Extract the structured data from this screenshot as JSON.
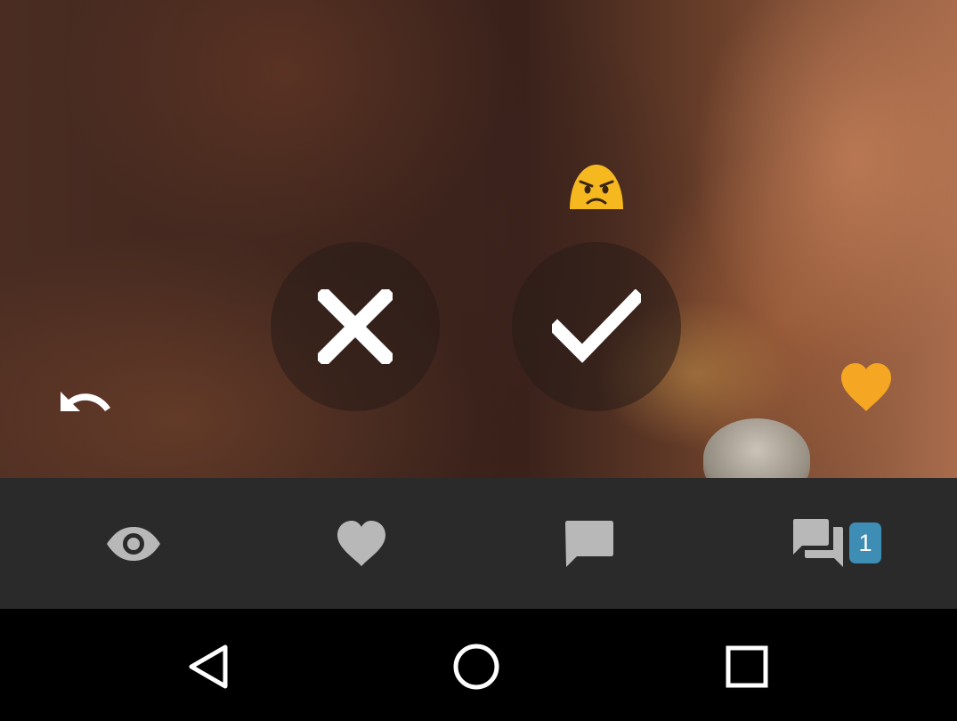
{
  "colors": {
    "accent_heart": "#F5A623",
    "emoji_yellow": "#F6B81F",
    "badge_bg": "#3E8DB5",
    "bar_icon": "#B8B8B8",
    "bar_background": "#2A2A2A",
    "nav_background": "#000000",
    "nav_icon": "#FFFFFF"
  },
  "photo_overlay": {
    "reaction_emoji": "angry-face-icon",
    "reject_icon": "close-icon",
    "accept_icon": "check-icon",
    "undo_icon": "undo-arrow-icon",
    "favorite_icon": "heart-icon"
  },
  "action_bar": {
    "items": [
      {
        "icon": "eye-icon"
      },
      {
        "icon": "heart-icon"
      },
      {
        "icon": "comment-icon"
      },
      {
        "icon": "forum-icon",
        "badge": "1"
      }
    ]
  },
  "nav_bar": {
    "back_icon": "back-triangle-icon",
    "home_icon": "home-circle-icon",
    "recents_icon": "recents-square-icon"
  }
}
